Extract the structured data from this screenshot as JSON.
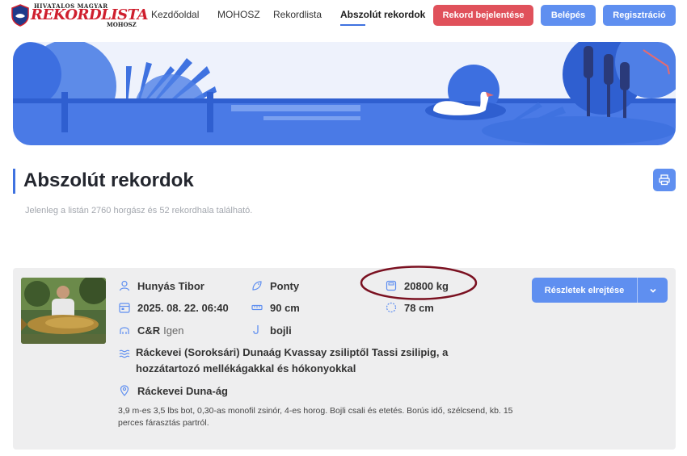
{
  "logo": {
    "top": "HIVATALOS MAGYAR",
    "main": "REKORDLISTA",
    "sub": "MOHOSZ"
  },
  "nav": {
    "links": [
      "Kezdőoldal",
      "MOHOSZ",
      "Rekordlista",
      "Abszolút rekordok"
    ],
    "report_btn": "Rekord bejelentése",
    "login_btn": "Belépés",
    "register_btn": "Regisztráció"
  },
  "page": {
    "title": "Abszolút rekordok",
    "subtitle": "Jelenleg a listán 2760 horgász és 52 rekordhala található."
  },
  "record": {
    "angler": "Hunyás Tibor",
    "date": "2025. 08. 22. 06:40",
    "cr_label": "C&R",
    "cr_value": "Igen",
    "species": "Ponty",
    "length": "90 cm",
    "bait": "bojli",
    "weight": "20800 kg",
    "girth": "78 cm",
    "water": "Ráckevei (Soroksári) Dunaág Kvassay zsiliptől Tassi zsilipig, a hozzátartozó mellékágakkal és hókonyokkal",
    "place": "Ráckevei Duna-ág",
    "description": "3,9 m-es 3,5 lbs bot, 0,30-as monofil zsinór, 4-es horog. Bojli csali és etetés. Borús idő, szélcsend, kb. 15 perces fárasztás partról.",
    "details_btn": "Részletek elrejtése"
  },
  "colors": {
    "accent": "#5f8ff0",
    "brand_red": "#cf1f2e",
    "report_red": "#e0515b",
    "highlight_oval": "#7a1020"
  }
}
